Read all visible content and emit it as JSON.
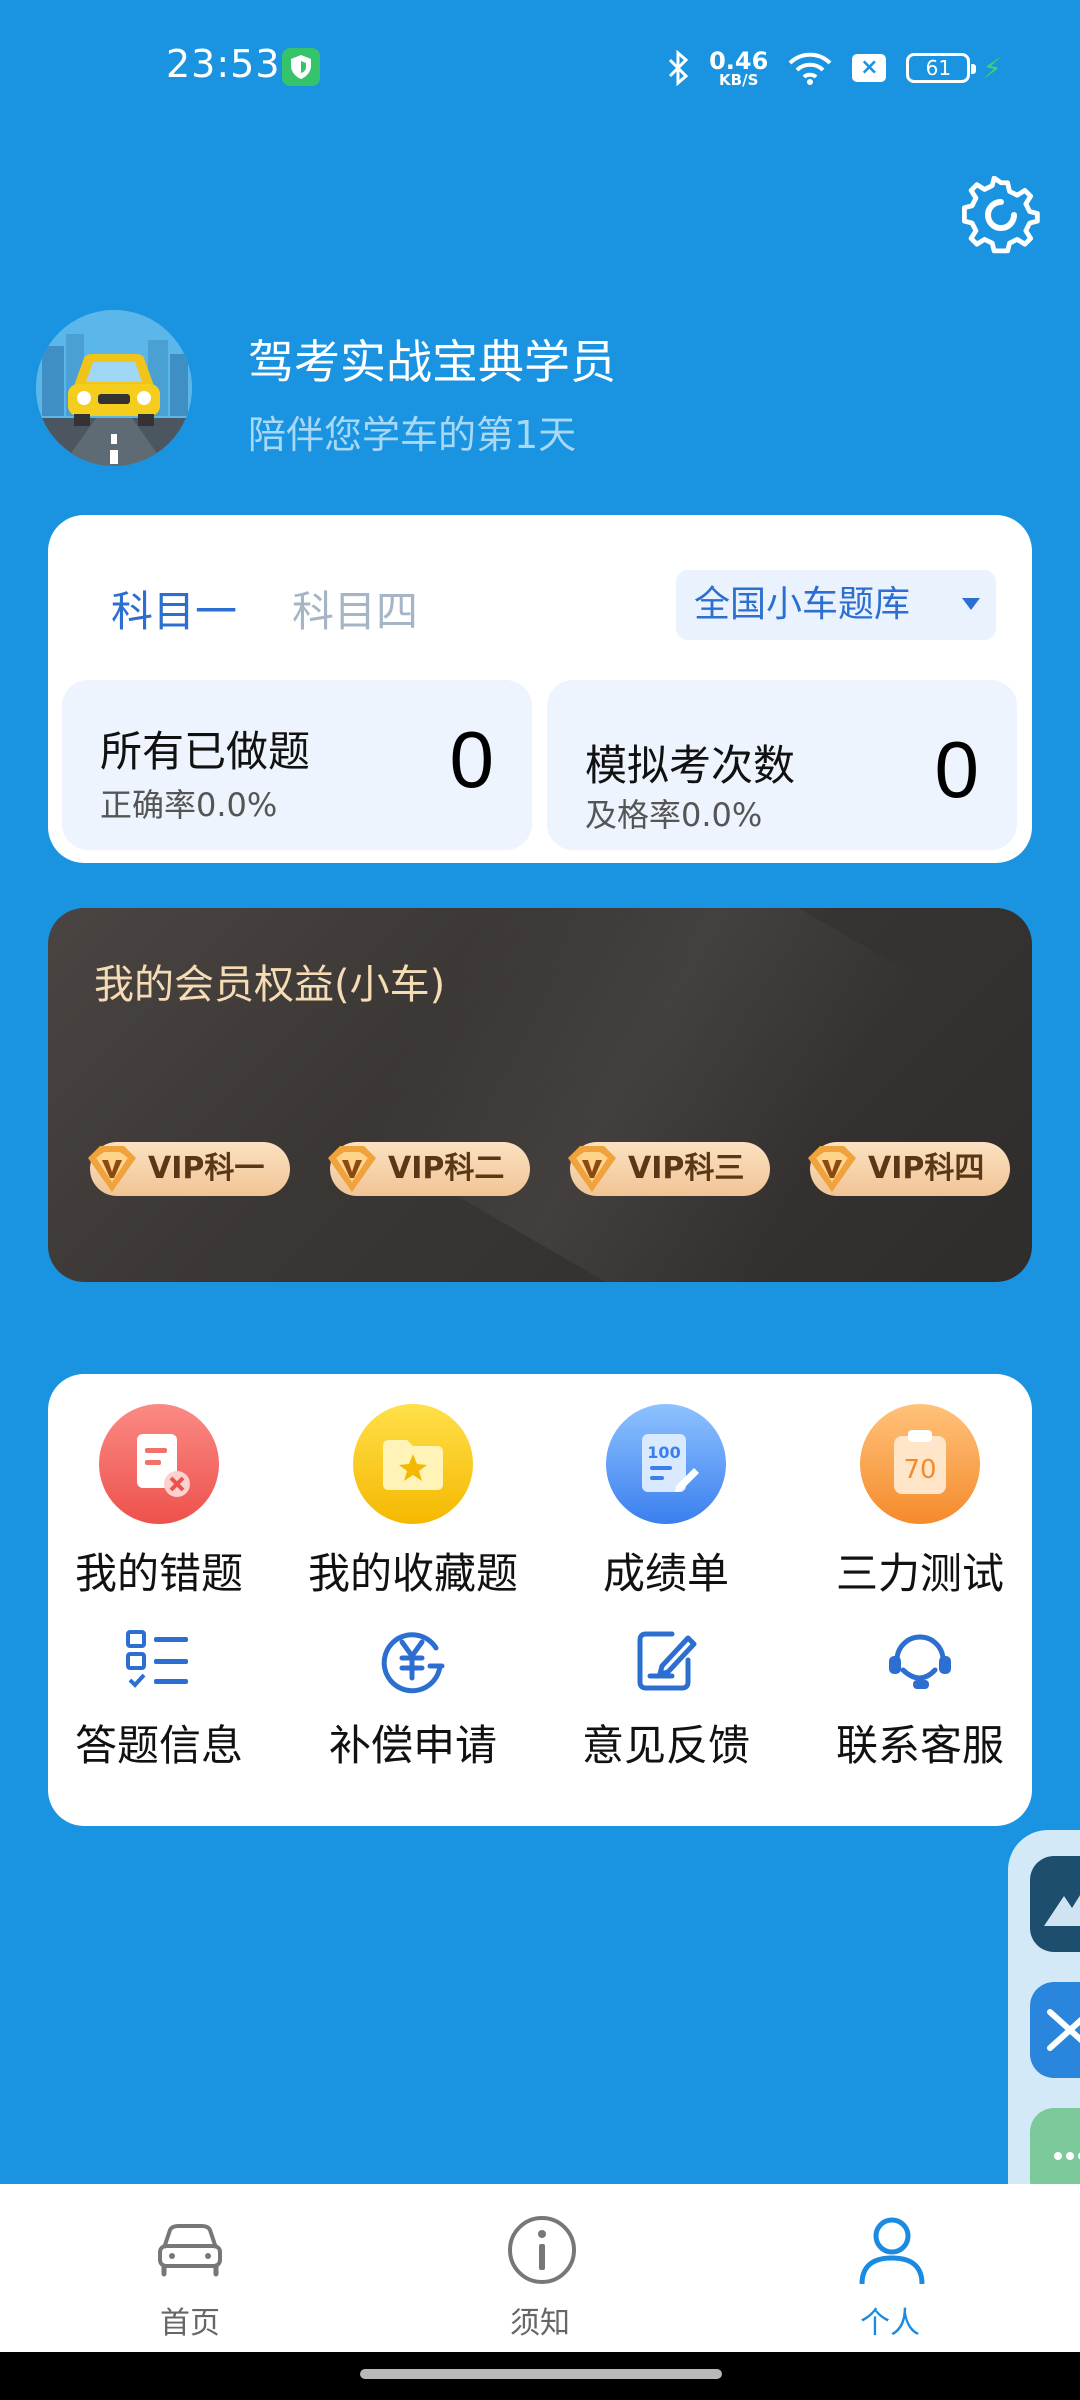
{
  "status_bar": {
    "time": "23:53",
    "net_speed_value": "0.46",
    "net_speed_unit": "KB/S",
    "battery": "61",
    "icons": [
      "shield-icon",
      "bluetooth-icon",
      "wifi-icon",
      "sim-x-icon",
      "battery-icon",
      "charging-icon"
    ]
  },
  "profile": {
    "name": "驾考实战宝典学员",
    "subtitle": "陪伴您学车的第1天"
  },
  "subjects": {
    "tabs": [
      "科目一",
      "科目四"
    ],
    "active_index": 0,
    "bank_selected": "全国小车题库"
  },
  "stats": {
    "done": {
      "title": "所有已做题",
      "rate": "正确率0.0%",
      "value": "0"
    },
    "mock": {
      "title": "模拟考次数",
      "rate": "及格率0.0%",
      "value": "0"
    }
  },
  "vip": {
    "title": "我的会员权益(小车)",
    "chips": [
      "VIP科一",
      "VIP科二",
      "VIP科三",
      "VIP科四"
    ]
  },
  "tools": {
    "row1": [
      {
        "label": "我的错题",
        "icon": "wrong-questions-icon",
        "color": "#f6625a"
      },
      {
        "label": "我的收藏题",
        "icon": "favorite-folder-icon",
        "color": "#f5c41a"
      },
      {
        "label": "成绩单",
        "icon": "score-sheet-icon",
        "color": "#3e8ef0"
      },
      {
        "label": "三力测试",
        "icon": "three-ability-test-icon",
        "color": "#f79a3c"
      }
    ],
    "row2": [
      {
        "label": "答题信息",
        "icon": "answer-info-icon"
      },
      {
        "label": "补偿申请",
        "icon": "compensation-icon"
      },
      {
        "label": "意见反馈",
        "icon": "feedback-icon"
      },
      {
        "label": "联系客服",
        "icon": "customer-service-icon"
      }
    ],
    "icon_color": "#2d6fd1"
  },
  "bottom_nav": {
    "items": [
      {
        "label": "首页",
        "icon": "car-icon"
      },
      {
        "label": "须知",
        "icon": "info-icon"
      },
      {
        "label": "个人",
        "icon": "person-icon"
      }
    ],
    "active_index": 2,
    "active_color": "#1a8be0"
  },
  "colors": {
    "background": "#1a94e0",
    "accent": "#2d6fd1",
    "vip_gold": "#f6dcb4"
  }
}
